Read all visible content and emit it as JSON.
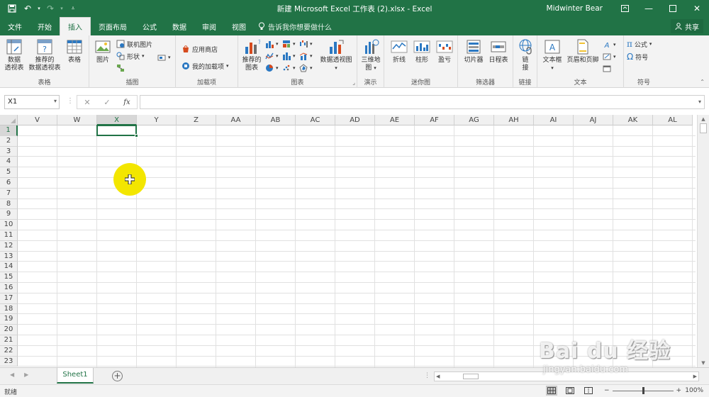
{
  "window": {
    "title": "新建 Microsoft Excel 工作表 (2).xlsx  -  Excel",
    "user": "Midwinter Bear",
    "accent": "#217346"
  },
  "tabs": [
    {
      "label": "文件",
      "active": false
    },
    {
      "label": "开始",
      "active": false
    },
    {
      "label": "插入",
      "active": true
    },
    {
      "label": "页面布局",
      "active": false
    },
    {
      "label": "公式",
      "active": false
    },
    {
      "label": "数据",
      "active": false
    },
    {
      "label": "审阅",
      "active": false
    },
    {
      "label": "视图",
      "active": false
    }
  ],
  "tell_me": "告诉我你想要做什么",
  "share_label": "共享",
  "ribbon": {
    "tables": {
      "label": "表格",
      "pivot": [
        "数据",
        "透视表"
      ],
      "recommended_pivot": [
        "推荐的",
        "数据透视表"
      ],
      "table": "表格"
    },
    "illustrations": {
      "label": "插图",
      "pictures": "图片",
      "online_pictures": "联机图片",
      "shapes": "形状"
    },
    "addins": {
      "label": "加载项",
      "store": "应用商店",
      "my_addins": "我的加载项"
    },
    "charts": {
      "label": "图表",
      "recommended": [
        "推荐的",
        "图表"
      ],
      "pivot_chart": "数据透视图"
    },
    "tours": {
      "label": "演示",
      "map3d": [
        "三维地",
        "图"
      ]
    },
    "sparklines": {
      "label": "迷你图",
      "line": "折线",
      "column": "柱形",
      "winloss": "盈亏"
    },
    "filters": {
      "label": "筛选器",
      "slicer": "切片器",
      "timeline": "日程表"
    },
    "links": {
      "label": "链接",
      "link": [
        "链",
        "接"
      ]
    },
    "text": {
      "label": "文本",
      "textbox": "文本框",
      "header_footer": "页眉和页脚"
    },
    "symbols": {
      "label": "符号",
      "equation": "公式",
      "symbol": "符号"
    }
  },
  "formula_bar": {
    "name_box": "X1",
    "cancel": "✕",
    "enter": "✓",
    "fx": "fx",
    "value": ""
  },
  "grid": {
    "columns": [
      "V",
      "W",
      "X",
      "Y",
      "Z",
      "AA",
      "AB",
      "AC",
      "AD",
      "AE",
      "AF",
      "AG",
      "AH",
      "AI",
      "AJ",
      "AK",
      "AL"
    ],
    "rows": [
      "1",
      "2",
      "3",
      "4",
      "5",
      "6",
      "7",
      "8",
      "9",
      "10",
      "11",
      "12",
      "13",
      "14",
      "15",
      "16",
      "17",
      "18",
      "19",
      "20",
      "21",
      "22",
      "23"
    ],
    "selected_column": "X",
    "selected_row": "1"
  },
  "sheets": [
    {
      "name": "Sheet1",
      "active": true
    }
  ],
  "status": {
    "ready": "就绪",
    "zoom": "100%"
  },
  "watermark": {
    "brand": "Bai du 经验",
    "url": "jingyan.baidu.com"
  }
}
